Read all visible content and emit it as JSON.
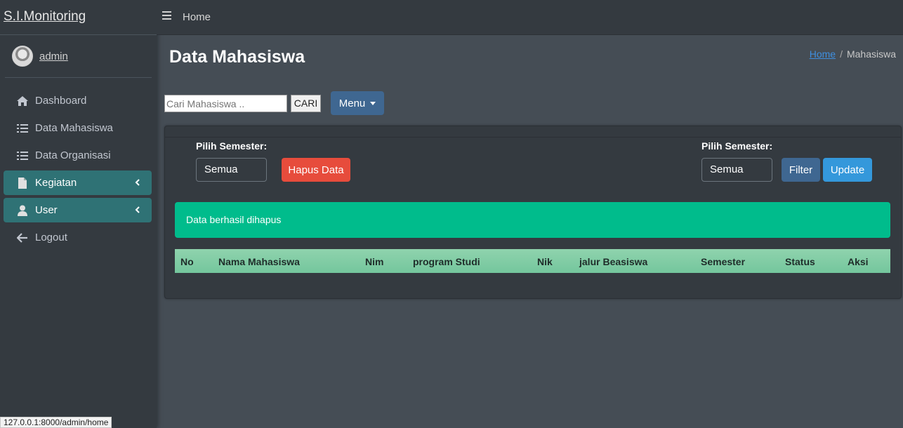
{
  "brand": "S.I.Monitoring",
  "user": {
    "name": "admin"
  },
  "nav": [
    {
      "label": "Dashboard",
      "icon": "home-icon"
    },
    {
      "label": "Data Mahasiswa",
      "icon": "list-icon"
    },
    {
      "label": "Data Organisasi",
      "icon": "list-icon"
    },
    {
      "label": "Kegiatan",
      "icon": "file-icon",
      "active": true
    },
    {
      "label": "User",
      "icon": "user-icon",
      "active": true
    },
    {
      "label": "Logout",
      "icon": "arrow-left-icon"
    }
  ],
  "topbar": {
    "home": "Home"
  },
  "page": {
    "title": "Data Mahasiswa",
    "breadcrumb": {
      "home": "Home",
      "sep": "/",
      "current": "Mahasiswa"
    }
  },
  "search": {
    "placeholder": "Cari Mahasiswa ..",
    "button": "CARI"
  },
  "menu_button": "Menu",
  "filters": {
    "left_label": "Pilih Semester:",
    "left_value": "Semua",
    "delete_button": "Hapus Data",
    "right_label": "Pilih Semester:",
    "right_value": "Semua",
    "filter_button": "Filter",
    "update_button": "Update"
  },
  "alert": "Data berhasil dihapus",
  "table": {
    "columns": [
      "No",
      "Nama Mahasiswa",
      "Nim",
      "program Studi",
      "Nik",
      "jalur Beasiswa",
      "Semester",
      "Status",
      "Aksi"
    ]
  },
  "statusbar": "127.0.0.1:8000/admin/home",
  "colors": {
    "sidebar": "#343a40",
    "content": "#454d55",
    "active_nav": "#2f7275",
    "alert": "#00bc8c",
    "danger": "#e74c3c",
    "primary": "#3f6791",
    "info": "#3498db",
    "table_head": "#7ecba2"
  }
}
